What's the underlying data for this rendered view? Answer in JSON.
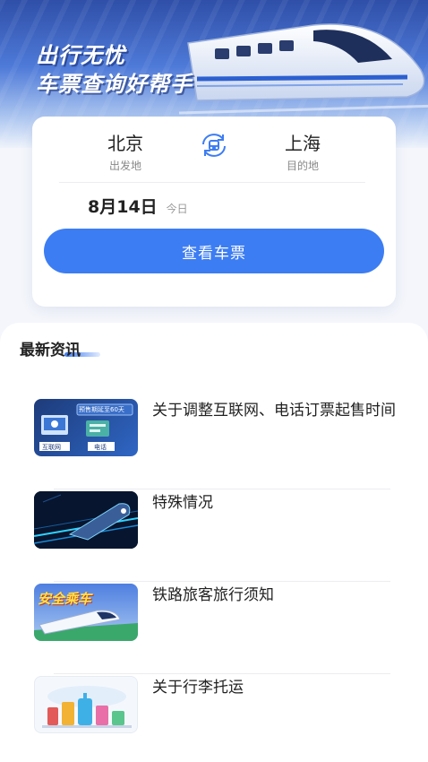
{
  "hero": {
    "slogan_line1": "出行无忧",
    "slogan_line2": "车票查询好帮手"
  },
  "search": {
    "from": {
      "city": "北京",
      "label": "出发地"
    },
    "to": {
      "city": "上海",
      "label": "目的地"
    },
    "date": "8月14日",
    "date_tag": "今日",
    "button_label": "查看车票"
  },
  "news": {
    "title": "最新资讯",
    "items": [
      {
        "title": "关于调整互联网、电话订票起售时间",
        "thumb_icon": "ticket-presale-thumb",
        "thumb_label_1": "预售期延至60天",
        "thumb_label_2": "互联网",
        "thumb_label_3": "电话"
      },
      {
        "title": "特殊情况",
        "thumb_icon": "night-train-thumb"
      },
      {
        "title": "铁路旅客旅行须知",
        "thumb_icon": "safe-ride-thumb",
        "thumb_label_1": "安全乘车"
      },
      {
        "title": "关于行李托运",
        "thumb_icon": "luggage-thumb"
      }
    ]
  },
  "colors": {
    "accent": "#3d7df3",
    "hero_top": "#2f4fa8",
    "page_bg": "#f4f6fb"
  }
}
